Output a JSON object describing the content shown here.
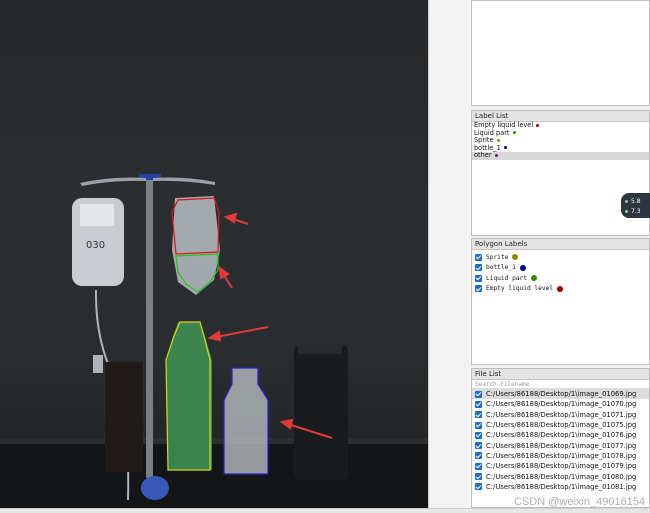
{
  "label_list": {
    "title": "Label List",
    "items": [
      {
        "label": "Empty liquid level",
        "color": "#8b0000"
      },
      {
        "label": "Liquid part",
        "color": "#2e8b00"
      },
      {
        "label": "Sprite",
        "color": "#8b8b00"
      },
      {
        "label": "bottle_1",
        "color": "#00008b"
      },
      {
        "label": "other",
        "color": "#8b008b",
        "selected": true
      }
    ]
  },
  "polygon_labels": {
    "title": "Polygon Labels",
    "items": [
      {
        "label": "Sprite",
        "color": "#8b8b00"
      },
      {
        "label": "bottle_1",
        "color": "#00008b"
      },
      {
        "label": "Liquid part",
        "color": "#2e8b00"
      },
      {
        "label": "Empty liquid level",
        "color": "#8b0000"
      }
    ]
  },
  "file_list": {
    "title": "File List",
    "search_placeholder": "Search Filename",
    "files": [
      "C:/Users/86188/Desktop/1\\image_01069.jpg",
      "C:/Users/86188/Desktop/1\\image_01070.jpg",
      "C:/Users/86188/Desktop/1\\image_01071.jpg",
      "C:/Users/86188/Desktop/1\\image_01075.jpg",
      "C:/Users/86188/Desktop/1\\image_01076.jpg",
      "C:/Users/86188/Desktop/1\\image_01077.jpg",
      "C:/Users/86188/Desktop/1\\image_01078.jpg",
      "C:/Users/86188/Desktop/1\\image_01079.jpg",
      "C:/Users/86188/Desktop/1\\image_01080.jpg",
      "C:/Users/86188/Desktop/1\\image_01081.jpg"
    ]
  },
  "float_widget": {
    "line1": "5.8",
    "line2": "7.3"
  },
  "watermark": "CSDN @weixin_49016154",
  "canvas": {
    "drip_bag_text": "030"
  }
}
